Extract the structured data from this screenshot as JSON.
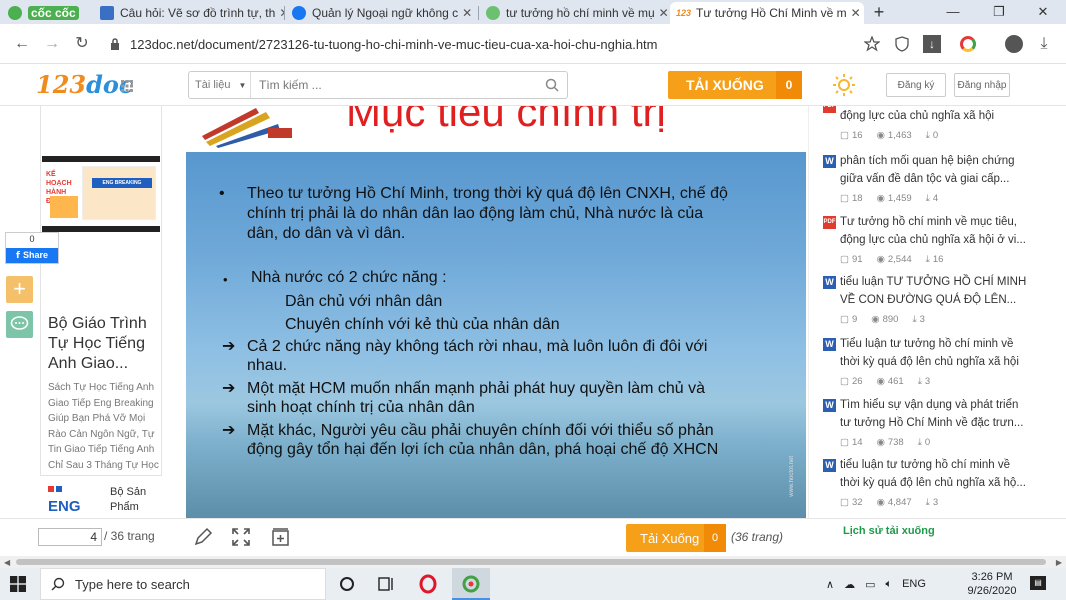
{
  "browser": {
    "tabs": [
      {
        "label": "cốc cốc",
        "kind": "home"
      },
      {
        "label": "Câu hỏi: Vẽ sơ đồ trình tự, th",
        "kind": "normal"
      },
      {
        "label": "Quản lý Ngoại ngữ không c",
        "kind": "normal"
      },
      {
        "label": "tư tưởng hồ chí minh về mụ",
        "kind": "normal"
      },
      {
        "label": "Tư tưởng Hồ Chí Minh về m",
        "kind": "active"
      }
    ],
    "new_tab_label": "+",
    "url": "123doc.net/document/2723126-tu-tuong-ho-chi-minh-ve-muc-tieu-cua-xa-hoi-chu-nghia.htm",
    "colors": {
      "tabbar": "#dfe6f0",
      "accent": "#f6a01a"
    }
  },
  "site": {
    "logo_main": "123",
    "logo_suffix": "doc",
    "search_category": "Tài liệu",
    "search_placeholder": "Tìm kiếm ...",
    "download_label": "TẢI XUỐNG",
    "download_count": "0",
    "register_label": "Đăng ký",
    "login_label": "Đăng nhập"
  },
  "left": {
    "share_count": "0",
    "share_label": "Share",
    "card_title": "Bộ Giáo Trình Tự Học Tiếng Anh Giao...",
    "card_desc": "Sách Tự Học Tiếng Anh Giao Tiếp Eng Breaking Giúp Bạn Phá Vỡ Mọi Rào Cản Ngôn Ngữ, Tự Tin Giao Tiếp Tiếng Anh Chỉ Sau 3 Tháng Tự Học",
    "thumb_heading": "KẾ HOẠCH HÀNH ĐỘNG",
    "thumb_brand": "ENG BREAKING",
    "product_label": "Bộ Sản Phẩm",
    "product_brand": "ENG"
  },
  "slide": {
    "title": "Mục tiêu chính trị",
    "p1": [
      "Theo tư tưởng Hồ Chí Minh, trong thời kỳ quá độ lên CNXH, chế độ",
      "chính trị phải là do nhân dân lao động làm chủ, Nhà nước là của",
      "dân, do dân và vì dân."
    ],
    "p2_head": "Nhà nước có 2 chức năng :",
    "p2_items": [
      "Dân chủ với nhân dân",
      "Chuyên chính với kẻ thù của nhân dân"
    ],
    "arrows": [
      [
        "Cả 2 chức năng này không tách rời nhau, mà luôn luôn đi đôi với",
        "nhau."
      ],
      [
        "Một mặt HCM muốn nhấn mạnh phải phát huy quyền làm chủ và",
        "sinh hoạt chính trị của nhân dân"
      ],
      [
        "Mặt khác, Người yêu cầu phải chuyên chính đối với thiểu số phản",
        "động gây tổn hại đến lợi ích của nhân dân, phá hoại chế độ XHCN"
      ]
    ],
    "watermark": "www.hoctot.net"
  },
  "related": [
    {
      "icon": "pdf",
      "title": [
        "động lực của chủ nghĩa xã hội",
        ""
      ],
      "pages": "16",
      "views": "1,463",
      "downloads": "0"
    },
    {
      "icon": "word",
      "title": [
        "phân tích mối quan hệ biện chứng",
        "giữa vấn đề dân tộc và giai cấp..."
      ],
      "pages": "18",
      "views": "1,459",
      "downloads": "4"
    },
    {
      "icon": "pdf",
      "title": [
        "Tư tưởng hồ chí minh về mục tiêu,",
        "động lực của chủ nghĩa xã hội ở vi..."
      ],
      "pages": "91",
      "views": "2,544",
      "downloads": "16"
    },
    {
      "icon": "word",
      "title": [
        "tiểu luận TƯ TƯỞNG HỒ CHÍ MINH",
        "VỀ CON ĐƯỜNG QUÁ ĐỘ LÊN..."
      ],
      "pages": "9",
      "views": "890",
      "downloads": "3"
    },
    {
      "icon": "word",
      "title": [
        "Tiểu luận tư tưởng hồ chí minh về",
        "thời kỳ quá độ lên chủ nghĩa xã hội"
      ],
      "pages": "26",
      "views": "461",
      "downloads": "3"
    },
    {
      "icon": "word",
      "title": [
        "Tìm hiểu sự vận dụng và phát triển",
        "tư tưởng Hồ Chí Minh về đặc trưn..."
      ],
      "pages": "14",
      "views": "738",
      "downloads": "0"
    },
    {
      "icon": "word",
      "title": [
        "tiểu luận tư tưởng hồ chí minh về",
        "thời kỳ quá độ lên chủ nghĩa xã hộ..."
      ],
      "pages": "32",
      "views": "4,847",
      "downloads": "3"
    }
  ],
  "bottom": {
    "page_current": "4",
    "page_total": "/ 36 trang",
    "download_label": "Tải Xuống",
    "download_count": "0",
    "download_pages": "(36 trang)",
    "history_label": "Lịch sử tải xuống"
  },
  "taskbar": {
    "search_placeholder": "Type here to search",
    "language": "ENG",
    "time": "3:26 PM",
    "date": "9/26/2020"
  }
}
